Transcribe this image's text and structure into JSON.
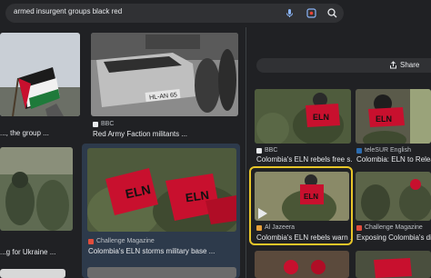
{
  "search": {
    "query": "armed insurgent groups black red"
  },
  "results": {
    "col1": [
      {
        "caption": "..., the group ..."
      },
      {
        "caption": "...g for Ukraine ..."
      }
    ],
    "col2": [
      {
        "source": "BBC",
        "caption": "Red Army Faction militants ...",
        "plate": "HL-AN 65"
      },
      {
        "source": "Challenge Magazine",
        "caption": "Colombia's ELN storms military base ...",
        "banner_text": "ELN"
      }
    ]
  },
  "panel": {
    "share_label": "Share",
    "items": [
      {
        "source": "BBC",
        "caption": "Colombia's ELN rebels free s...",
        "banner_text": "ELN"
      },
      {
        "source": "teleSUR English",
        "caption": "Colombia: ELN to Release ...",
        "banner_text": "ELN"
      },
      {
        "source": "Al Jazeera",
        "caption": "Colombia's ELN rebels warn ...",
        "banner_text": "ELN"
      },
      {
        "source": "Challenge Magazine",
        "caption": "Exposing Colombia's dirt..."
      }
    ]
  },
  "colors": {
    "background": "#202124",
    "highlight": "#e8c629",
    "selected_card": "#2d3a4b",
    "banner_red": "#c8102e"
  }
}
